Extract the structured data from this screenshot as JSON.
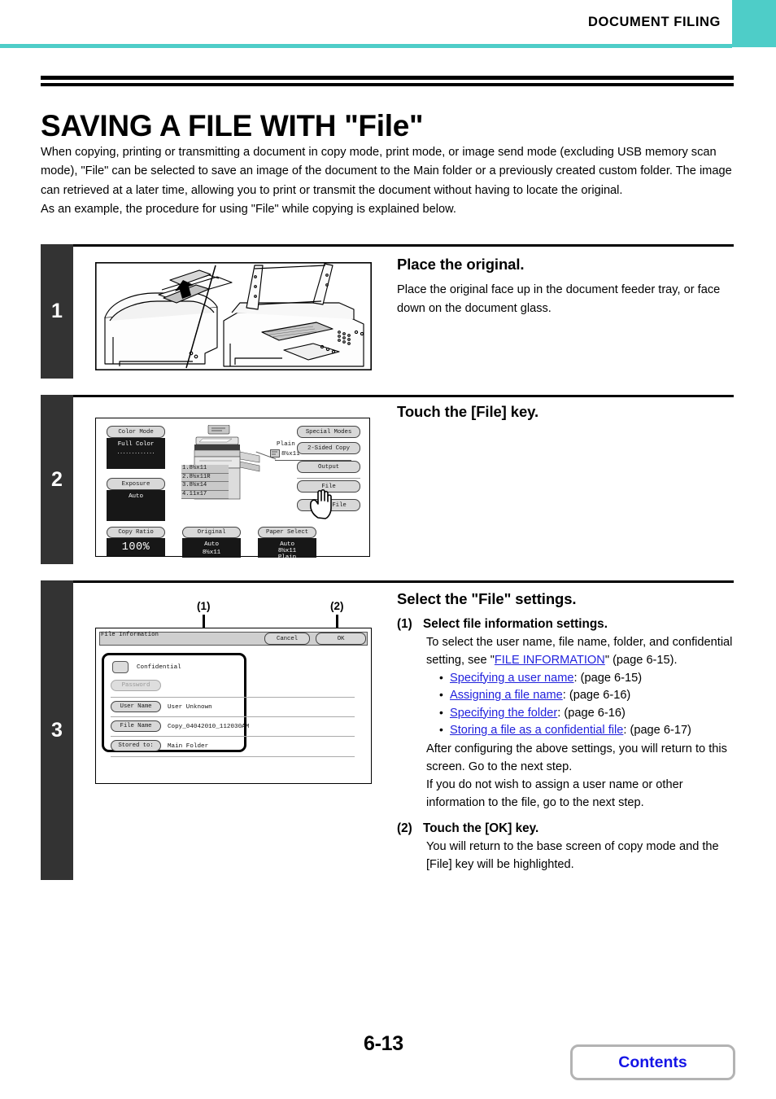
{
  "header": {
    "title": "DOCUMENT FILING",
    "accent_color": "#4ecdc8"
  },
  "page_title": "SAVING A FILE WITH \"File\"",
  "intro": {
    "paragraph1": "When copying, printing or transmitting a document in copy mode, print mode, or image send mode (excluding USB memory scan mode), \"File\" can be selected to save an image of the document to the Main folder or a previously created custom folder. The image can retrieved at a later time, allowing you to print or transmit the document without having to locate the original.",
    "paragraph2": "As an example, the procedure for using \"File\" while copying is explained below."
  },
  "steps": [
    {
      "number": "1",
      "heading": "Place the original.",
      "text": "Place the original face up in the document feeder tray, or face down on the document glass.",
      "art": "mfp-document-feeder-photo"
    },
    {
      "number": "2",
      "heading": "Touch the [File] key.",
      "text": ""
    },
    {
      "number": "3",
      "heading": "Select the \"File\" settings.",
      "substeps": [
        {
          "num": "(1)",
          "head": "Select file information settings.",
          "line1_pre": "To select the user name, file name, folder, and confidential setting, see \"",
          "link1": "FILE INFORMATION",
          "line1_post": "\" (page 6-15).",
          "bullets": [
            {
              "link": "Specifying a user name",
              "tail": ": (page 6-15)"
            },
            {
              "link": "Assigning a file name",
              "tail": ": (page 6-16)"
            },
            {
              "link": "Specifying the folder",
              "tail": ": (page 6-16)"
            },
            {
              "link": "Storing a file as a confidential file",
              "tail": ": (page 6-17)"
            }
          ],
          "after1": "After configuring the above settings, you will return to this screen. Go to the next step.",
          "after2": "If you do not wish to assign a user name or other information to the file, go to the next step."
        },
        {
          "num": "(2)",
          "head": "Touch the [OK] key.",
          "body": "You will return to the base screen of copy mode and the [File] key will be highlighted."
        }
      ]
    }
  ],
  "copy_screen": {
    "left_keys": [
      {
        "label": "Color Mode",
        "value": "Full Color",
        "dots": "............."
      },
      {
        "label": "Exposure",
        "value": "Auto"
      }
    ],
    "right_keys": [
      "Special Modes",
      "2-Sided Copy",
      "Output",
      "File",
      "Quick File"
    ],
    "bottom_keys": [
      {
        "label": "Copy Ratio",
        "value": "100%"
      },
      {
        "label": "Original",
        "value": "Auto",
        "sub": "8½x11"
      },
      {
        "label": "Paper Select",
        "value": "Auto",
        "sub": "8½x11",
        "sub2": "Plain"
      }
    ],
    "paper_trays": [
      "1.8½x11",
      "2.8½x11R",
      "3.8½x14",
      "4.11x17"
    ],
    "bypass_label": "Plain",
    "bypass_size": "8½x11",
    "cursor": "hand-pointer-icon"
  },
  "file_info_dialog": {
    "title": "File Information",
    "cancel_label": "Cancel",
    "ok_label": "OK",
    "confidential_label": "Confidential",
    "password_label": "Password",
    "rows": [
      {
        "key": "User Name",
        "value": "User Unknown"
      },
      {
        "key": "File Name",
        "value": "Copy_04042010_112030AM"
      },
      {
        "key": "Stored to:",
        "value": "Main Folder"
      }
    ],
    "callouts": [
      "(1)",
      "(2)"
    ]
  },
  "footer": {
    "page_number": "6-13",
    "contents_label": "Contents",
    "contents_color": "#1414e6"
  }
}
